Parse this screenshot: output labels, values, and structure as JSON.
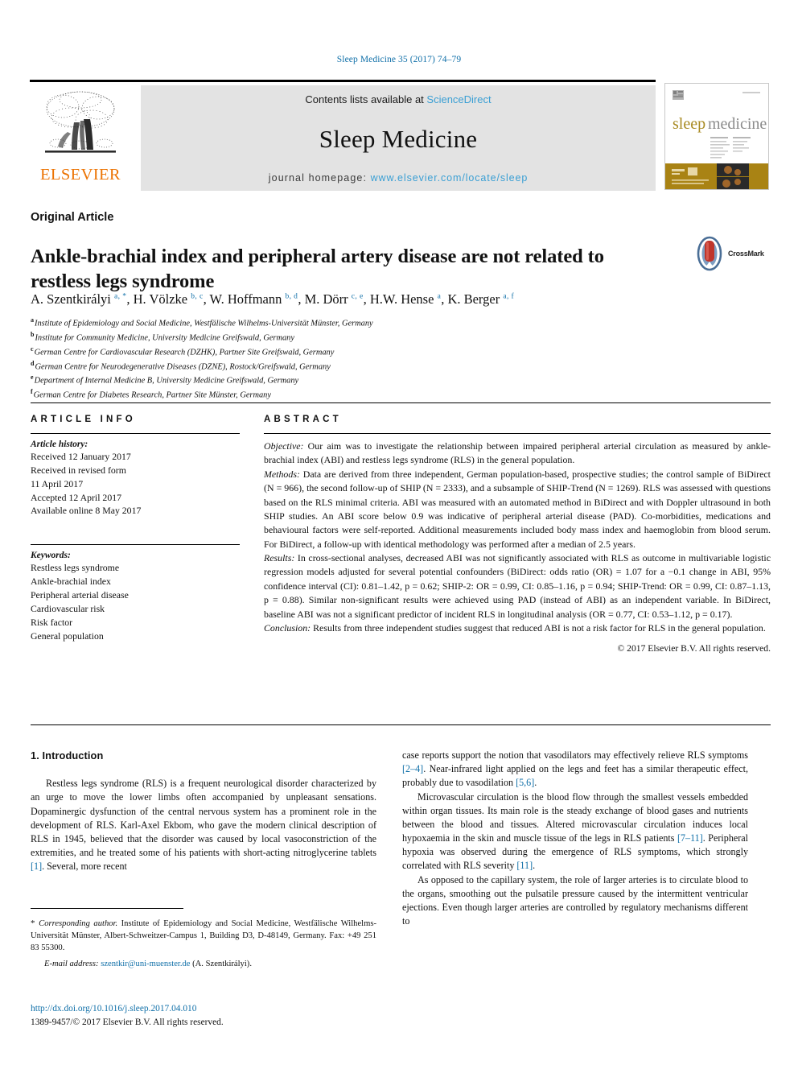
{
  "running_head": "Sleep Medicine 35 (2017) 74–79",
  "masthead": {
    "publisher": "ELSEVIER",
    "contents_prefix": "Contents lists available at ",
    "contents_link": "ScienceDirect",
    "journal_name": "Sleep Medicine",
    "homepage_prefix": "journal homepage: ",
    "homepage_url": "www.elsevier.com/locate/sleep",
    "cover_title_a": "sleep",
    "cover_title_b": "medicine"
  },
  "article": {
    "type": "Original Article",
    "title": "Ankle-brachial index and peripheral artery disease are not related to restless legs syndrome",
    "crossmark_label": "CrossMark",
    "authors": [
      {
        "name": "A. Szentkirályi",
        "marks": "a, *"
      },
      {
        "name": "H. Völzke",
        "marks": "b, c"
      },
      {
        "name": "W. Hoffmann",
        "marks": "b, d"
      },
      {
        "name": "M. Dörr",
        "marks": "c, e"
      },
      {
        "name": "H.W. Hense",
        "marks": "a"
      },
      {
        "name": "K. Berger",
        "marks": "a, f"
      }
    ],
    "affiliations": [
      {
        "mark": "a",
        "text": "Institute of Epidemiology and Social Medicine, Westfälische Wilhelms-Universität Münster, Germany"
      },
      {
        "mark": "b",
        "text": "Institute for Community Medicine, University Medicine Greifswald, Germany"
      },
      {
        "mark": "c",
        "text": "German Centre for Cardiovascular Research (DZHK), Partner Site Greifswald, Germany"
      },
      {
        "mark": "d",
        "text": "German Centre for Neurodegenerative Diseases (DZNE), Rostock/Greifswald, Germany"
      },
      {
        "mark": "e",
        "text": "Department of Internal Medicine B, University Medicine Greifswald, Germany"
      },
      {
        "mark": "f",
        "text": "German Centre for Diabetes Research, Partner Site Münster, Germany"
      }
    ]
  },
  "article_info": {
    "heading": "ARTICLE INFO",
    "history_label": "Article history:",
    "history": [
      "Received 12 January 2017",
      "Received in revised form",
      "11 April 2017",
      "Accepted 12 April 2017",
      "Available online 8 May 2017"
    ],
    "keywords_label": "Keywords:",
    "keywords": [
      "Restless legs syndrome",
      "Ankle-brachial index",
      "Peripheral arterial disease",
      "Cardiovascular risk",
      "Risk factor",
      "General population"
    ]
  },
  "abstract": {
    "heading": "ABSTRACT",
    "objective_label": "Objective:",
    "objective_text": " Our aim was to investigate the relationship between impaired peripheral arterial circulation as measured by ankle-brachial index (ABI) and restless legs syndrome (RLS) in the general population.",
    "methods_label": "Methods:",
    "methods_text": " Data are derived from three independent, German population-based, prospective studies; the control sample of BiDirect (N = 966), the second follow-up of SHIP (N = 2333), and a subsample of SHIP-Trend (N = 1269). RLS was assessed with questions based on the RLS minimal criteria. ABI was measured with an automated method in BiDirect and with Doppler ultrasound in both SHIP studies. An ABI score below 0.9 was indicative of peripheral arterial disease (PAD). Co-morbidities, medications and behavioural factors were self-reported. Additional measurements included body mass index and haemoglobin from blood serum. For BiDirect, a follow-up with identical methodology was performed after a median of 2.5 years.",
    "results_label": "Results:",
    "results_text": " In cross-sectional analyses, decreased ABI was not significantly associated with RLS as outcome in multivariable logistic regression models adjusted for several potential confounders (BiDirect: odds ratio (OR) = 1.07 for a −0.1 change in ABI, 95% confidence interval (CI): 0.81–1.42, p = 0.62; SHIP-2: OR = 0.99, CI: 0.85–1.16, p = 0.94; SHIP-Trend: OR = 0.99, CI: 0.87–1.13, p = 0.88). Similar non-significant results were achieved using PAD (instead of ABI) as an independent variable. In BiDirect, baseline ABI was not a significant predictor of incident RLS in longitudinal analysis (OR = 0.77, CI: 0.53–1.12, p = 0.17).",
    "conclusion_label": "Conclusion:",
    "conclusion_text": " Results from three independent studies suggest that reduced ABI is not a risk factor for RLS in the general population.",
    "copyright": "© 2017 Elsevier B.V. All rights reserved."
  },
  "introduction": {
    "heading": "1. Introduction",
    "left_paragraphs": [
      "Restless legs syndrome (RLS) is a frequent neurological disorder characterized by an urge to move the lower limbs often accompanied by unpleasant sensations. Dopaminergic dysfunction of the central nervous system has a prominent role in the development of RLS. Karl-Axel Ekbom, who gave the modern clinical description of RLS in 1945, believed that the disorder was caused by local vasoconstriction of the extremities, and he treated some of his patients with short-acting nitroglycerine tablets [1]. Several, more recent"
    ],
    "right_paragraphs": [
      "case reports support the notion that vasodilators may effectively relieve RLS symptoms [2–4]. Near-infrared light applied on the legs and feet has a similar therapeutic effect, probably due to vasodilation [5,6].",
      "Microvascular circulation is the blood flow through the smallest vessels embedded within organ tissues. Its main role is the steady exchange of blood gases and nutrients between the blood and tissues. Altered microvascular circulation induces local hypoxaemia in the skin and muscle tissue of the legs in RLS patients [7–11]. Peripheral hypoxia was observed during the emergence of RLS symptoms, which strongly correlated with RLS severity [11].",
      "As opposed to the capillary system, the role of larger arteries is to circulate blood to the organs, smoothing out the pulsatile pressure caused by the intermittent ventricular ejections. Even though larger arteries are controlled by regulatory mechanisms different to"
    ]
  },
  "footnote": {
    "corresponding_label": "Corresponding author.",
    "corresponding_text": " Institute of Epidemiology and Social Medicine, Westfälische Wilhelms-Universität Münster, Albert-Schweitzer-Campus 1, Building D3, D-48149, Germany. Fax: +49 251 83 55300.",
    "email_label": "E-mail address:",
    "email": "szentkir@uni-muenster.de",
    "email_suffix": " (A. Szentkirályi)."
  },
  "doi_block": {
    "doi": "http://dx.doi.org/10.1016/j.sleep.2017.04.010",
    "issn": "1389-9457/© 2017 Elsevier B.V. All rights reserved."
  },
  "colors": {
    "link": "#0f6fa8",
    "science_direct": "#3a9fd4",
    "elsevier_orange": "#ec7404",
    "banner_gray": "#e3e3e3"
  }
}
